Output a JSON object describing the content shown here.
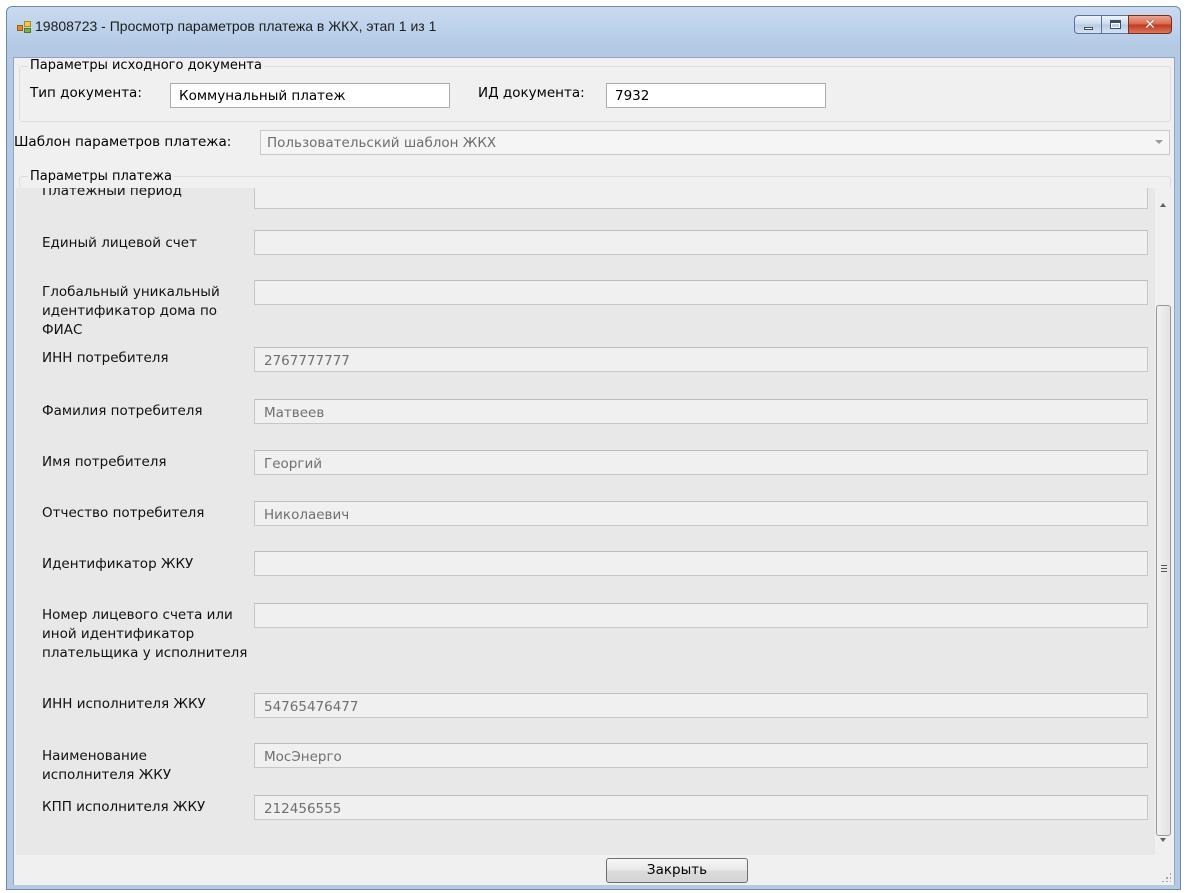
{
  "window": {
    "title": "19808723 - Просмотр параметров платежа в ЖКХ, этап 1 из 1",
    "controls": {
      "minimize": "minimize-icon",
      "maximize": "maximize-icon",
      "close": "close-icon"
    }
  },
  "source_doc": {
    "legend": "Параметры исходного документа",
    "doc_type_label": "Тип документа:",
    "doc_type_value": "Коммунальный платеж",
    "doc_id_label": "ИД документа:",
    "doc_id_value": "7932"
  },
  "template": {
    "label": "Шаблон параметров платежа:",
    "value": "Пользовательский шаблон ЖКХ"
  },
  "payment": {
    "legend": "Параметры платежа",
    "rows": [
      {
        "label": "Платежный период",
        "value": ""
      },
      {
        "label": "Единый лицевой счет",
        "value": ""
      },
      {
        "label": "Глобальный уникальный идентификатор дома по ФИАС",
        "value": ""
      },
      {
        "label": "ИНН потребителя",
        "value": "2767777777"
      },
      {
        "label": "Фамилия потребителя",
        "value": "Матвеев"
      },
      {
        "label": "Имя потребителя",
        "value": "Георгий"
      },
      {
        "label": "Отчество потребителя",
        "value": "Николаевич"
      },
      {
        "label": "Идентификатор ЖКУ",
        "value": ""
      },
      {
        "label": "Номер лицевого счета или иной идентификатор плательщика у исполнителя",
        "value": ""
      },
      {
        "label": "ИНН исполнителя ЖКУ",
        "value": "54765476477"
      },
      {
        "label": "Наименование исполнителя ЖКУ",
        "value": "МосЭнерго"
      },
      {
        "label": "КПП исполнителя ЖКУ",
        "value": "212456555"
      }
    ]
  },
  "footer": {
    "close_label": "Закрыть"
  },
  "colors": {
    "titlebar": "#b9cfe9",
    "client_bg": "#f0f0f0",
    "panel_bg": "#e8e8e8",
    "close_btn": "#c2391b"
  }
}
